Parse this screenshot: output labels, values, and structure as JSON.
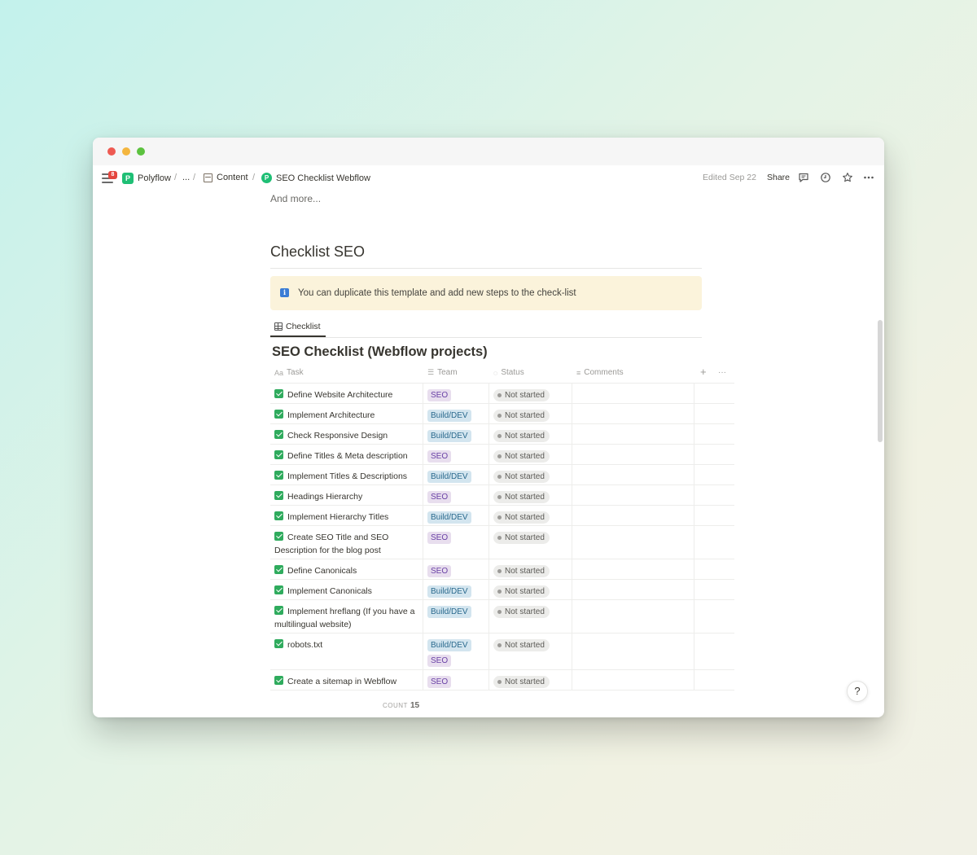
{
  "breadcrumb": {
    "notification_count": "8",
    "workspace": "Polyflow",
    "ellipsis": "...",
    "parent": "Content",
    "current": "SEO Checklist Webflow"
  },
  "topbar": {
    "edited": "Edited Sep 22",
    "share": "Share"
  },
  "page": {
    "and_more": "And more...",
    "section_heading": "Checklist SEO",
    "callout_text": "You can duplicate this template and add new steps to the check-list",
    "view_tab": "Checklist",
    "db_title": "SEO Checklist (Webflow projects)"
  },
  "table": {
    "columns": [
      "Task",
      "Team",
      "Status",
      "Comments"
    ],
    "add_label": "+",
    "more_label": "···",
    "rows": [
      {
        "task": "Define Website Architecture",
        "team": [
          "SEO"
        ],
        "status": "Not started"
      },
      {
        "task": "Implement Architecture",
        "team": [
          "Build/DEV"
        ],
        "status": "Not started"
      },
      {
        "task": "Check Responsive Design",
        "team": [
          "Build/DEV"
        ],
        "status": "Not started"
      },
      {
        "task": "Define Titles & Meta description",
        "team": [
          "SEO"
        ],
        "status": "Not started"
      },
      {
        "task": "Implement Titles & Descriptions",
        "team": [
          "Build/DEV"
        ],
        "status": "Not started"
      },
      {
        "task": "Headings Hierarchy",
        "team": [
          "SEO"
        ],
        "status": "Not started"
      },
      {
        "task": "Implement Hierarchy Titles",
        "team": [
          "Build/DEV"
        ],
        "status": "Not started"
      },
      {
        "task": "Create SEO Title and SEO Description for the blog post",
        "team": [
          "SEO"
        ],
        "status": "Not started"
      },
      {
        "task": "Define Canonicals",
        "team": [
          "SEO"
        ],
        "status": "Not started"
      },
      {
        "task": "Implement Canonicals",
        "team": [
          "Build/DEV"
        ],
        "status": "Not started"
      },
      {
        "task": "Implement hreflang (If you have a multilingual website)",
        "team": [
          "Build/DEV"
        ],
        "status": "Not started"
      },
      {
        "task": "robots.txt",
        "team": [
          "Build/DEV",
          "SEO"
        ],
        "status": "Not started"
      },
      {
        "task": "Create a sitemap in Webflow",
        "team": [
          "SEO"
        ],
        "status": "Not started"
      }
    ],
    "count_label": "COUNT",
    "count_value": "15"
  },
  "help_label": "?",
  "colors": {
    "seo_tag_bg": "#e8deee",
    "build_tag_bg": "#d3e5ef",
    "callout_bg": "#fbf3db",
    "checkbox": "#2fab5d",
    "logo": "#1fbf75"
  },
  "icons": [
    "menu-icon",
    "polyflow-logo-icon",
    "book-icon",
    "comment-icon",
    "clock-icon",
    "star-icon",
    "more-icon",
    "info-icon",
    "table-icon",
    "checkbox-icon"
  ]
}
